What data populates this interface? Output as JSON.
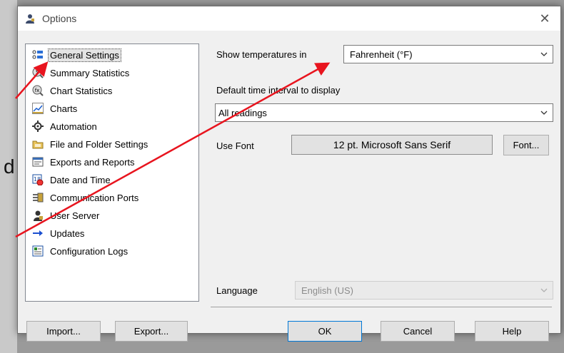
{
  "background": {
    "letter": "d"
  },
  "window": {
    "title": "Options",
    "close_glyph": "✕"
  },
  "nav": {
    "items": [
      {
        "label": "General Settings",
        "icon": "settings-list-icon",
        "selected": true
      },
      {
        "label": "Summary Statistics",
        "icon": "summary-statistics-icon"
      },
      {
        "label": "Chart Statistics",
        "icon": "chart-statistics-icon"
      },
      {
        "label": "Charts",
        "icon": "line-chart-icon"
      },
      {
        "label": "Automation",
        "icon": "gear-icon"
      },
      {
        "label": "File and Folder Settings",
        "icon": "folder-icon"
      },
      {
        "label": "Exports and Reports",
        "icon": "report-icon"
      },
      {
        "label": "Date and Time",
        "icon": "calendar-clock-icon"
      },
      {
        "label": "Communication Ports",
        "icon": "port-icon"
      },
      {
        "label": "User Server",
        "icon": "user-server-icon"
      },
      {
        "label": "Updates",
        "icon": "arrow-right-icon"
      },
      {
        "label": "Configuration Logs",
        "icon": "log-icon"
      }
    ]
  },
  "settings": {
    "temp_label": "Show temperatures in",
    "temp_value": "Fahrenheit (°F)",
    "interval_label": "Default time interval to display",
    "interval_value": "All readings",
    "font_label": "Use Font",
    "font_value": "12 pt. Microsoft Sans Serif",
    "font_button": "Font...",
    "language_label": "Language",
    "language_value": "English (US)"
  },
  "buttons": {
    "import": "Import...",
    "export": "Export...",
    "ok": "OK",
    "cancel": "Cancel",
    "help": "Help"
  },
  "colors": {
    "annotation_arrow": "#e8141e",
    "selection": "#e4e4e4"
  }
}
